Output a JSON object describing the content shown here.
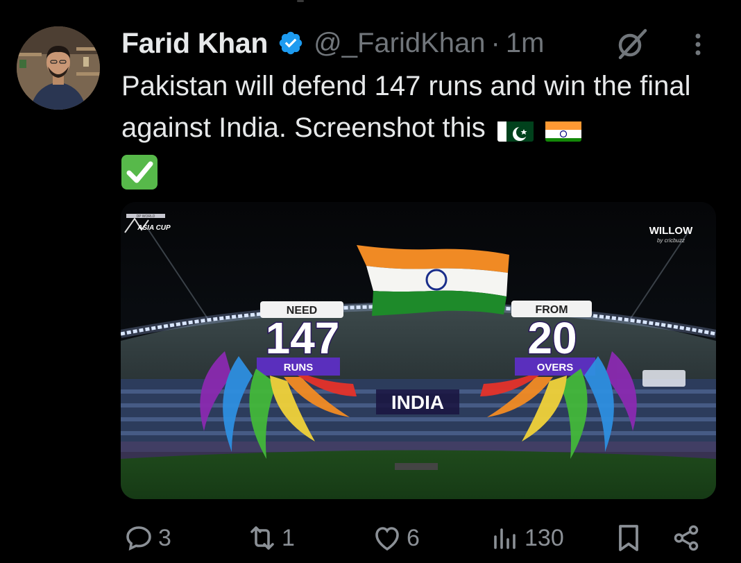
{
  "tweet": {
    "author_name": "Farid Khan",
    "handle": "@_FaridKhan",
    "separator": "·",
    "time": "1m",
    "text": "Pakistan will defend 147 runs and win the final against India. Screenshot this"
  },
  "media": {
    "broadcaster": "WILLOW",
    "broadcaster_sub": "by cricbuzz",
    "event": "ASIA CUP",
    "event_sponsor": "DP WORLD",
    "need_label": "NEED",
    "runs_value": "147",
    "runs_label": "RUNS",
    "from_label": "FROM",
    "overs_value": "20",
    "overs_label": "OVERS",
    "team": "INDIA"
  },
  "actions": {
    "replies": "3",
    "reposts": "1",
    "likes": "6",
    "views": "130"
  },
  "icons": [
    "verified-badge-icon",
    "grok-icon",
    "more-icon",
    "pakistan-flag-icon",
    "india-flag-icon",
    "check-mark-icon",
    "reply-icon",
    "repost-icon",
    "like-icon",
    "views-icon",
    "bookmark-icon",
    "share-icon"
  ],
  "colors": {
    "background": "#000000",
    "text_primary": "#e7e9ea",
    "text_secondary": "#71767b",
    "verified_blue": "#1d9bf0",
    "action_gray": "#8b9096"
  }
}
